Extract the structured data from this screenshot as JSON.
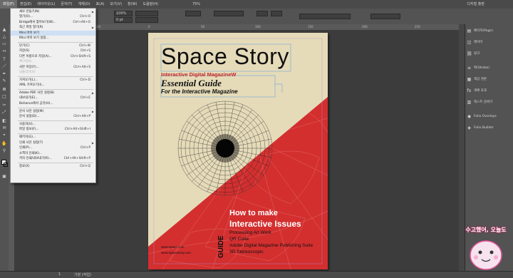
{
  "menubar": {
    "items": [
      "파일(F)",
      "편집(E)",
      "레이아웃(L)",
      "문자(T)",
      "개체(O)",
      "표(A)",
      "보기(V)",
      "창(W)",
      "도움말(H)"
    ],
    "zoom": "75%",
    "workspace": "디지털 출판"
  },
  "controlbar": {
    "zoom_field": "100%",
    "stroke_field": "0 pt"
  },
  "file_menu": {
    "items": [
      {
        "label": "새로 만들기(N)",
        "shortcut": "",
        "submenu": true,
        "disabled": false
      },
      {
        "label": "열기(O)...",
        "shortcut": "Ctrl+O",
        "submenu": false,
        "disabled": false
      },
      {
        "label": "Bridge에서 찾아보기(W)...",
        "shortcut": "Ctrl+Alt+O",
        "submenu": false,
        "disabled": false
      },
      {
        "label": "최근 파일 열기(R)",
        "shortcut": "",
        "submenu": true,
        "disabled": false
      },
      {
        "label": "Mini 바이 보기",
        "shortcut": "",
        "submenu": false,
        "disabled": false,
        "highlight": true
      },
      {
        "label": "Mini 바이 보기 설정...",
        "shortcut": "",
        "submenu": false,
        "disabled": false
      },
      {
        "label": "닫기(C)",
        "shortcut": "Ctrl+W",
        "submenu": false,
        "disabled": false
      },
      {
        "label": "저장(S)",
        "shortcut": "Ctrl+S",
        "submenu": false,
        "disabled": false
      },
      {
        "label": "다른 이름으로 저장(A)...",
        "shortcut": "Ctrl+Shift+S",
        "submenu": false,
        "disabled": false
      },
      {
        "label": "체크인(I)...",
        "shortcut": "",
        "submenu": false,
        "disabled": true
      },
      {
        "label": "사본 저장(Y)...",
        "shortcut": "Ctrl+Alt+S",
        "submenu": false,
        "disabled": false
      },
      {
        "label": "되돌리기(V)",
        "shortcut": "",
        "submenu": false,
        "disabled": true
      },
      {
        "label": "가져오기(L)...",
        "shortcut": "Ctrl+D",
        "submenu": false,
        "disabled": false
      },
      {
        "label": "XML 가져오기(I)...",
        "shortcut": "",
        "submenu": false,
        "disabled": false
      },
      {
        "label": "Adobe PDF 사전 설정(B)",
        "shortcut": "",
        "submenu": true,
        "disabled": false
      },
      {
        "label": "내보내기(E)...",
        "shortcut": "Ctrl+E",
        "submenu": false,
        "disabled": false
      },
      {
        "label": "Behance에서 공유(H)...",
        "shortcut": "",
        "submenu": false,
        "disabled": false
      },
      {
        "label": "문서 사전 설정(M)",
        "shortcut": "",
        "submenu": true,
        "disabled": false
      },
      {
        "label": "문서 설정(D)...",
        "shortcut": "Ctrl+Alt+P",
        "submenu": false,
        "disabled": false
      },
      {
        "label": "사용자(U)...",
        "shortcut": "",
        "submenu": false,
        "disabled": false
      },
      {
        "label": "파일 정보(F)...",
        "shortcut": "Ctrl+Alt+Shift+I",
        "submenu": false,
        "disabled": false
      },
      {
        "label": "패키지(G)...",
        "shortcut": "",
        "submenu": false,
        "disabled": false
      },
      {
        "label": "인쇄 사전 설정(T)",
        "shortcut": "",
        "submenu": true,
        "disabled": false
      },
      {
        "label": "인쇄(P)...",
        "shortcut": "Ctrl+P",
        "submenu": false,
        "disabled": false
      },
      {
        "label": "소책자 인쇄(K)...",
        "shortcut": "",
        "submenu": false,
        "disabled": false
      },
      {
        "label": "격자 인쇄/내보내기(R)...",
        "shortcut": "Ctrl+Alt+Shift+P",
        "submenu": false,
        "disabled": false
      },
      {
        "label": "종료(X)",
        "shortcut": "Ctrl+Q",
        "submenu": false,
        "disabled": false
      }
    ]
  },
  "right_panel": {
    "items": [
      "페이지(Page)",
      "레이어",
      "링크",
      "획(Stroke)",
      "색상 견본",
      "개체 효과",
      "텍스트 감싸기",
      "Folio Overlays",
      "Folio Builder"
    ]
  },
  "cover": {
    "title": "Space Story",
    "subtitle": "Interactive Digital MagazineW",
    "guide_title": "Essential Guide",
    "guide_sub": "For the Interactive Magazine",
    "how_line1": "How to make",
    "how_line2": "Interactive Issues",
    "vertical": "GUIDE",
    "list": [
      "Processing Art Work",
      "QR Code",
      "Adobe Digital Magazine Publishing Suite",
      "3D Stereoscopic"
    ],
    "url1": "www.space.com",
    "url2": "www.spacestory.com"
  },
  "statusbar": {
    "page": "1",
    "status": "기본 (작업)"
  },
  "badge": {
    "text": "수고했어, 오늘도"
  },
  "colors": {
    "accent_red": "#d32f2f",
    "page_cream": "#e5dbb9",
    "app_bg": "#3a3a3a"
  }
}
